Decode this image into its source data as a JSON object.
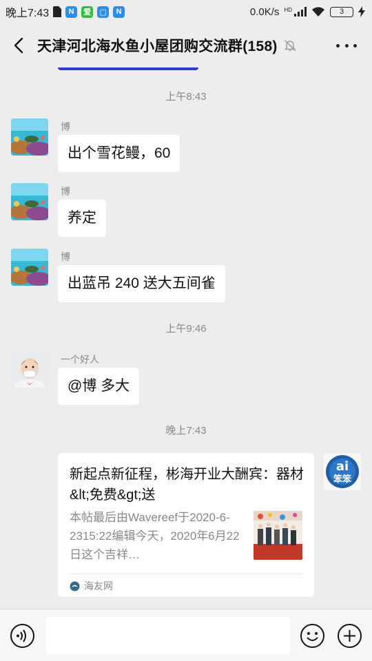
{
  "status_bar": {
    "time": "晚上7:43",
    "network_speed": "0.0K/s",
    "hd_label": "HD",
    "battery": "3",
    "app_badges": [
      "N",
      "爱",
      "N"
    ]
  },
  "header": {
    "title": "天津河北海水鱼小屋团购交流群(158)"
  },
  "chat": {
    "timestamps": [
      "上午8:43",
      "上午9:46",
      "晚上7:43"
    ],
    "messages": [
      {
        "sender": "博",
        "text": "出个雪花鳗，60"
      },
      {
        "sender": "博",
        "text": "养定"
      },
      {
        "sender": "博",
        "text": "出蓝吊 240 送大五间雀"
      },
      {
        "sender": "一个好人",
        "text": "@博  多大"
      }
    ],
    "link_card": {
      "title": "新起点新征程，彬海开业大酬宾：器材&lt;免费&gt;送",
      "description": "本帖最后由Wavereef于2020-6-2315:22编辑今天，2020年6月22日这个吉祥…",
      "source": "海友网"
    }
  },
  "input_bar": {
    "placeholder": ""
  },
  "icons": {
    "back": "back-arrow-icon",
    "mute": "bell-off-icon",
    "more": "more-dots-icon",
    "voice": "voice-icon",
    "emoji": "emoji-icon",
    "plus": "plus-icon"
  },
  "colors": {
    "background": "#ededed",
    "bubble": "#ffffff",
    "meta_text": "#888888"
  }
}
